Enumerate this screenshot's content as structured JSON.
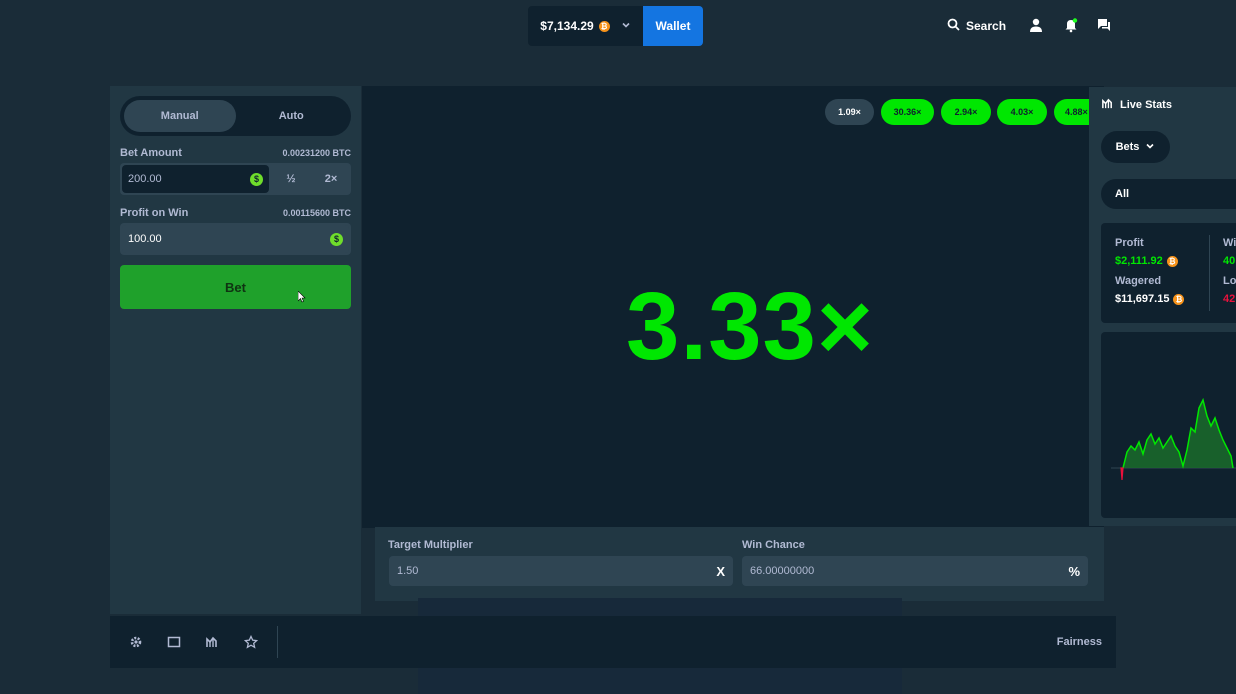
{
  "header": {
    "balance": "$7,134.29",
    "wallet_label": "Wallet",
    "search_label": "Search",
    "coin_symbol": "₿",
    "accent_color": "#1475e1"
  },
  "bet_panel": {
    "tabs": [
      {
        "label": "Manual",
        "active": true
      },
      {
        "label": "Auto",
        "active": false
      }
    ],
    "bet_amount": {
      "label": "Bet Amount",
      "btc": "0.00231200 BTC",
      "value": "200.00",
      "half_label": "½",
      "double_label": "2×"
    },
    "profit_on_win": {
      "label": "Profit on Win",
      "btc": "0.00115600 BTC",
      "value": "100.00"
    },
    "bet_button_label": "Bet",
    "dollar_symbol": "$"
  },
  "game": {
    "result_multiplier": "3.33×",
    "result_color": "#00e701",
    "recent_results": [
      {
        "label": "1.09×",
        "style": "grey"
      },
      {
        "label": "30.36×",
        "style": "green"
      },
      {
        "label": "2.94×",
        "style": "green"
      },
      {
        "label": "4.03×",
        "style": "green"
      },
      {
        "label": "4.88×",
        "style": "green"
      }
    ]
  },
  "controls": {
    "target_multiplier_label": "Target Multiplier",
    "target_multiplier_value": "1.50",
    "target_multiplier_suffix": "X",
    "win_chance_label": "Win Chance",
    "win_chance_value": "66.00000000",
    "win_chance_suffix": "%"
  },
  "footer": {
    "icons": [
      "settings-icon",
      "theatre-mode-icon",
      "live-stats-icon",
      "favourite-icon"
    ],
    "fairness_label": "Fairness"
  },
  "live_stats": {
    "title": "Live Stats",
    "bets_dropdown": "Bets",
    "filter": "All",
    "profit_label": "Profit",
    "profit_value": "$2,111.92",
    "wagered_label": "Wagered",
    "wagered_value": "$11,697.15",
    "wins_label": "Wi",
    "wins_value": "40",
    "losses_label": "Lo",
    "losses_value": "42",
    "profit_color": "#00e701",
    "loss_color": "#e9113c"
  }
}
